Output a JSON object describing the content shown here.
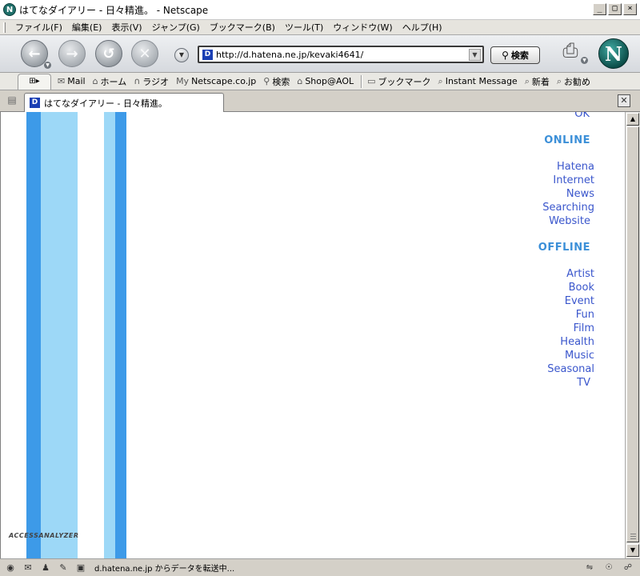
{
  "window": {
    "title": "はてなダイアリー - 日々精進。 - Netscape",
    "app_icon": "N",
    "minimize": "_",
    "maximize": "□",
    "close": "×"
  },
  "menu": [
    "ファイル(F)",
    "編集(E)",
    "表示(V)",
    "ジャンプ(G)",
    "ブックマーク(B)",
    "ツール(T)",
    "ウィンドウ(W)",
    "ヘルプ(H)"
  ],
  "nav": {
    "back_icon": "back-arrow-icon",
    "forward_icon": "forward-arrow-icon",
    "reload_icon": "reload-icon",
    "stop_icon": "stop-icon",
    "url_favicon": "D",
    "url": "http://d.hatena.ne.jp/kevaki4641/",
    "search_label": "検索",
    "logo_letter": "N"
  },
  "bookmarks": [
    {
      "icon": "mail-icon",
      "glyph": "✉",
      "label": "Mail"
    },
    {
      "icon": "home-icon",
      "glyph": "⌂",
      "label": "ホーム"
    },
    {
      "icon": "radio-icon",
      "glyph": "∩",
      "label": "ラジオ"
    },
    {
      "icon": "my-icon",
      "glyph": "My",
      "label": "Netscape.co.jp"
    },
    {
      "icon": "search-icon",
      "glyph": "⚲",
      "label": "検索"
    },
    {
      "icon": "shop-icon",
      "glyph": "⌂",
      "label": "Shop@AOL"
    },
    {
      "icon": "folder-icon",
      "glyph": "▭",
      "label": "ブックマーク"
    },
    {
      "icon": "bookmark-icon",
      "glyph": "⌕",
      "label": "Instant Message"
    },
    {
      "icon": "bookmark-icon",
      "glyph": "⌕",
      "label": "新着"
    },
    {
      "icon": "bookmark-icon",
      "glyph": "⌕",
      "label": "お勧め"
    }
  ],
  "tab": {
    "favicon": "D",
    "label": "はてなダイアリー - 日々精進。"
  },
  "page": {
    "partial_top": "OK",
    "online_heading": "ONLINE",
    "online_links": [
      "Hatena",
      "Internet",
      "News",
      "Searching",
      "Website"
    ],
    "offline_heading": "OFFLINE",
    "offline_links": [
      "Artist",
      "Book",
      "Event",
      "Fun",
      "Film",
      "Health",
      "Music",
      "Seasonal",
      "TV"
    ],
    "access_logo": "ACCESSANALYZER",
    "colors": {
      "stripe_dark": "#3d9ae8",
      "stripe_light": "#9dd8f7",
      "heading": "#3b8fd8",
      "link": "#3a56cc"
    }
  },
  "status": {
    "text": "d.hatena.ne.jp からデータを転送中..."
  }
}
